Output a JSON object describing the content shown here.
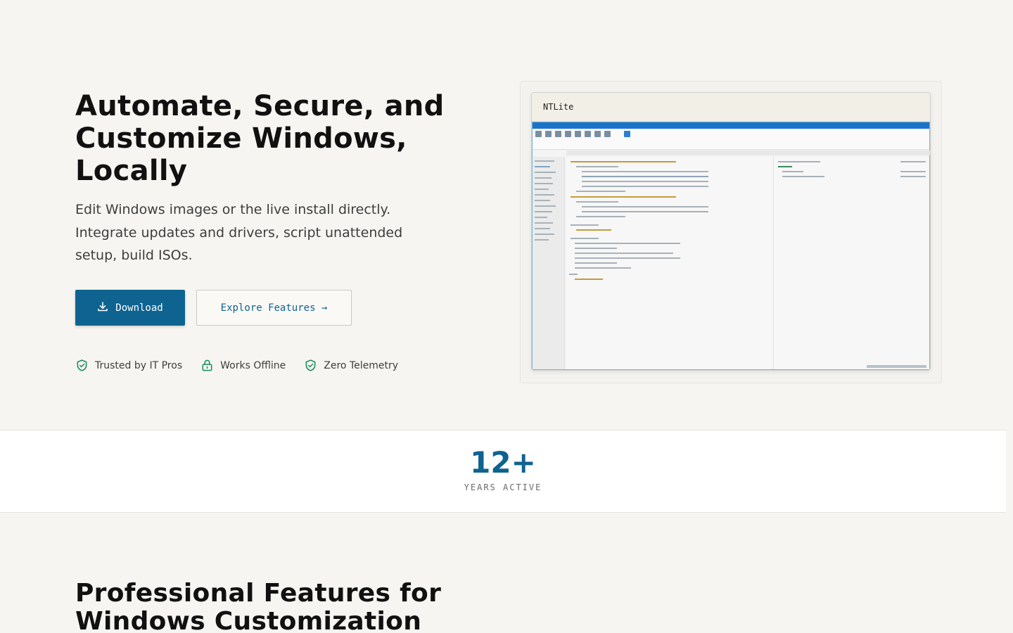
{
  "hero": {
    "title": "Automate, Secure, and Customize Windows, Locally",
    "subtitle": "Edit Windows images or the live install directly. Integrate updates and drivers, script unattended setup, build ISOs.",
    "download_label": "Download",
    "explore_label": "Explore Features →",
    "badges": [
      "Trusted by IT Pros",
      "Works Offline",
      "Zero Telemetry"
    ]
  },
  "screenshot": {
    "window_title": "NTLite"
  },
  "stats": {
    "value": "12+",
    "label": "YEARS ACTIVE"
  },
  "features": {
    "title": "Professional Features for Windows Customization"
  },
  "colors": {
    "accent": "#0e6390",
    "badge_icon": "#1a8a5a",
    "background": "#f6f5f1"
  },
  "icons": [
    "download-icon",
    "arrow-right-icon",
    "shield-check-icon",
    "lock-icon"
  ]
}
